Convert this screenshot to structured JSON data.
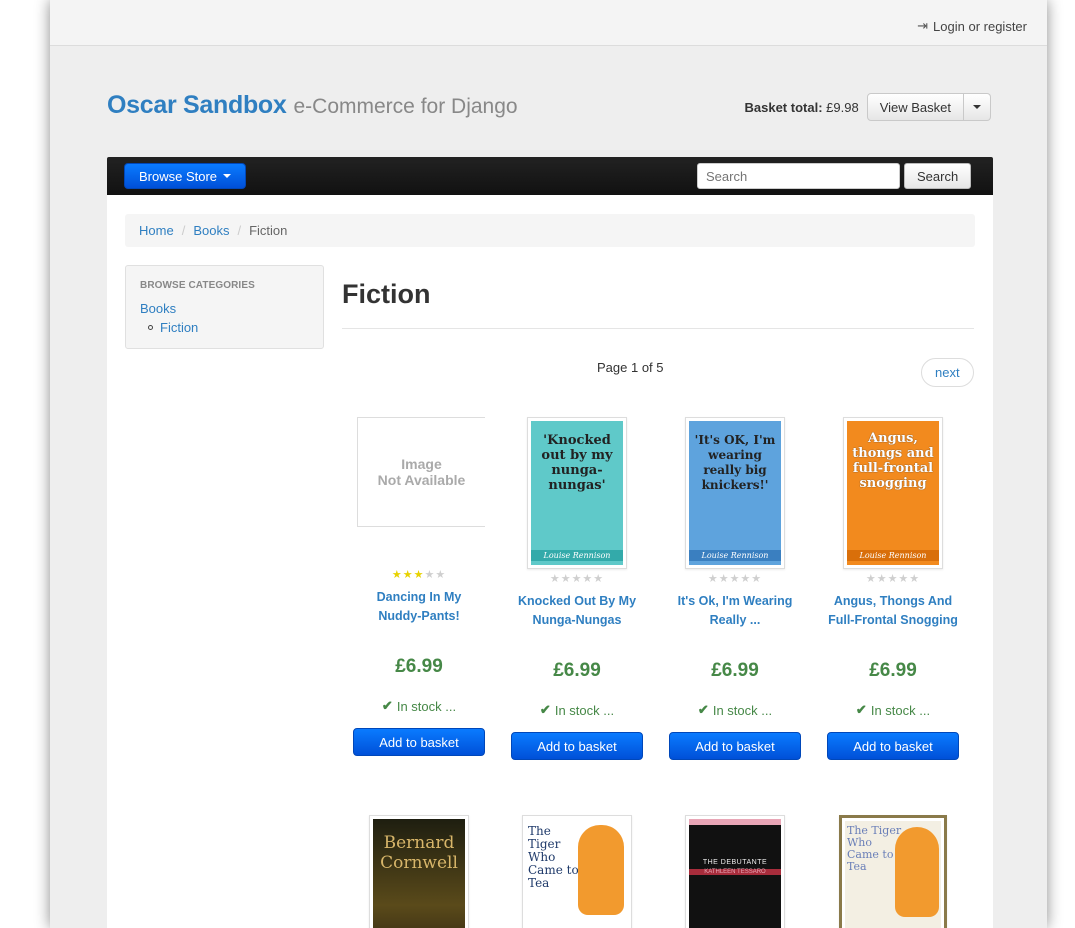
{
  "topbar": {
    "login_label": "Login or register"
  },
  "brand": {
    "name": "Oscar Sandbox",
    "tagline": "e-Commerce for Django"
  },
  "basket": {
    "total_label": "Basket total:",
    "total_value": "£9.98",
    "view_label": "View Basket"
  },
  "nav": {
    "browse_label": "Browse Store",
    "search_placeholder": "Search",
    "search_button": "Search"
  },
  "breadcrumb": {
    "home": "Home",
    "books": "Books",
    "current": "Fiction"
  },
  "sidebar": {
    "title": "Browse Categories",
    "category": "Books",
    "subcategory": "Fiction"
  },
  "main": {
    "heading": "Fiction",
    "page_info": "Page 1 of 5",
    "next_label": "next"
  },
  "products": [
    {
      "title": "Dancing In My Nuddy-Pants!",
      "rating": 3,
      "price": "£6.99",
      "stock": "In stock ...",
      "button": "Add to basket",
      "image": "Image Not Available",
      "image_line1": "Image",
      "image_line2": "Not Available"
    },
    {
      "title": "Knocked Out By My Nunga-Nungas",
      "rating": 0,
      "price": "£6.99",
      "stock": "In stock ...",
      "button": "Add to basket",
      "cover_title": "'Knocked out by my nunga-nungas'",
      "cover_author": "Louise Rennison",
      "cover_color": "#5fc9c9"
    },
    {
      "title": "It's Ok, I'm Wearing Really ...",
      "rating": 0,
      "price": "£6.99",
      "stock": "In stock ...",
      "button": "Add to basket",
      "cover_title": "'It's OK, I'm wearing really big knickers!'",
      "cover_author": "Louise Rennison",
      "cover_color": "#5ea3dd"
    },
    {
      "title": "Angus, Thongs And Full-Frontal Snogging",
      "rating": 0,
      "price": "£6.99",
      "stock": "In stock ...",
      "button": "Add to basket",
      "cover_title": "Angus, thongs and full-frontal snogging",
      "cover_author": "Louise Rennison",
      "cover_color": "#f28a1e"
    }
  ],
  "products_row2": [
    {
      "cover_title": "Bernard Cornwell",
      "cover_color": "#2a2a1a"
    },
    {
      "cover_title": "The Tiger Who Came to Tea",
      "cover_color": "#ffffff"
    },
    {
      "cover_title": "THE DEBUTANTE",
      "cover_subtitle": "KATHLEEN TESSARO",
      "cover_color": "#111111"
    },
    {
      "cover_title": "The Tiger Who Came to Tea",
      "cover_color": "#f3efe3"
    }
  ]
}
